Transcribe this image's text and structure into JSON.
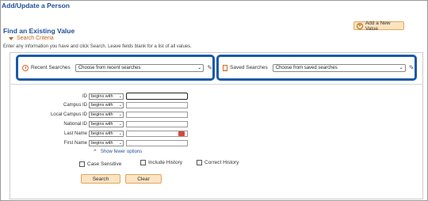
{
  "header": {
    "page_title": "Add/Update a Person",
    "add_new_label": "Add a New Value"
  },
  "find": {
    "title": "Find an Existing Value",
    "criteria_label": "Search Criteria",
    "instructions": "Enter any information you have and click Search. Leave fields blank for a list of all values."
  },
  "recent": {
    "label": "Recent Searches",
    "placeholder": "Choose from recent searches"
  },
  "saved": {
    "label": "Saved Searches",
    "placeholder": "Choose from saved searches"
  },
  "fields": [
    {
      "label": "ID",
      "operator": "begins with"
    },
    {
      "label": "Campus ID",
      "operator": "begins with"
    },
    {
      "label": "Local Campus ID",
      "operator": "begins with"
    },
    {
      "label": "National ID",
      "operator": "begins with"
    },
    {
      "label": "Last Name",
      "operator": "begins with"
    },
    {
      "label": "First Name",
      "operator": "begins with"
    }
  ],
  "show_fewer": "Show fewer options",
  "checkboxes": {
    "case_sensitive": "Case Sensitive",
    "include_history": "Include History",
    "correct_history": "Correct History"
  },
  "buttons": {
    "search": "Search",
    "clear": "Clear"
  },
  "icons": {
    "recent": "clock-icon",
    "saved": "bookmark-icon",
    "edit": "pencil-icon",
    "add": "plus-circle-icon",
    "calendar": "calendar-icon",
    "collapse": "chevron-up-icon"
  },
  "colors": {
    "title_blue": "#1f4e99",
    "accent_orange": "#c0601a",
    "button_fill": "#fbe3c3",
    "highlight_border": "#1a5aa8"
  }
}
